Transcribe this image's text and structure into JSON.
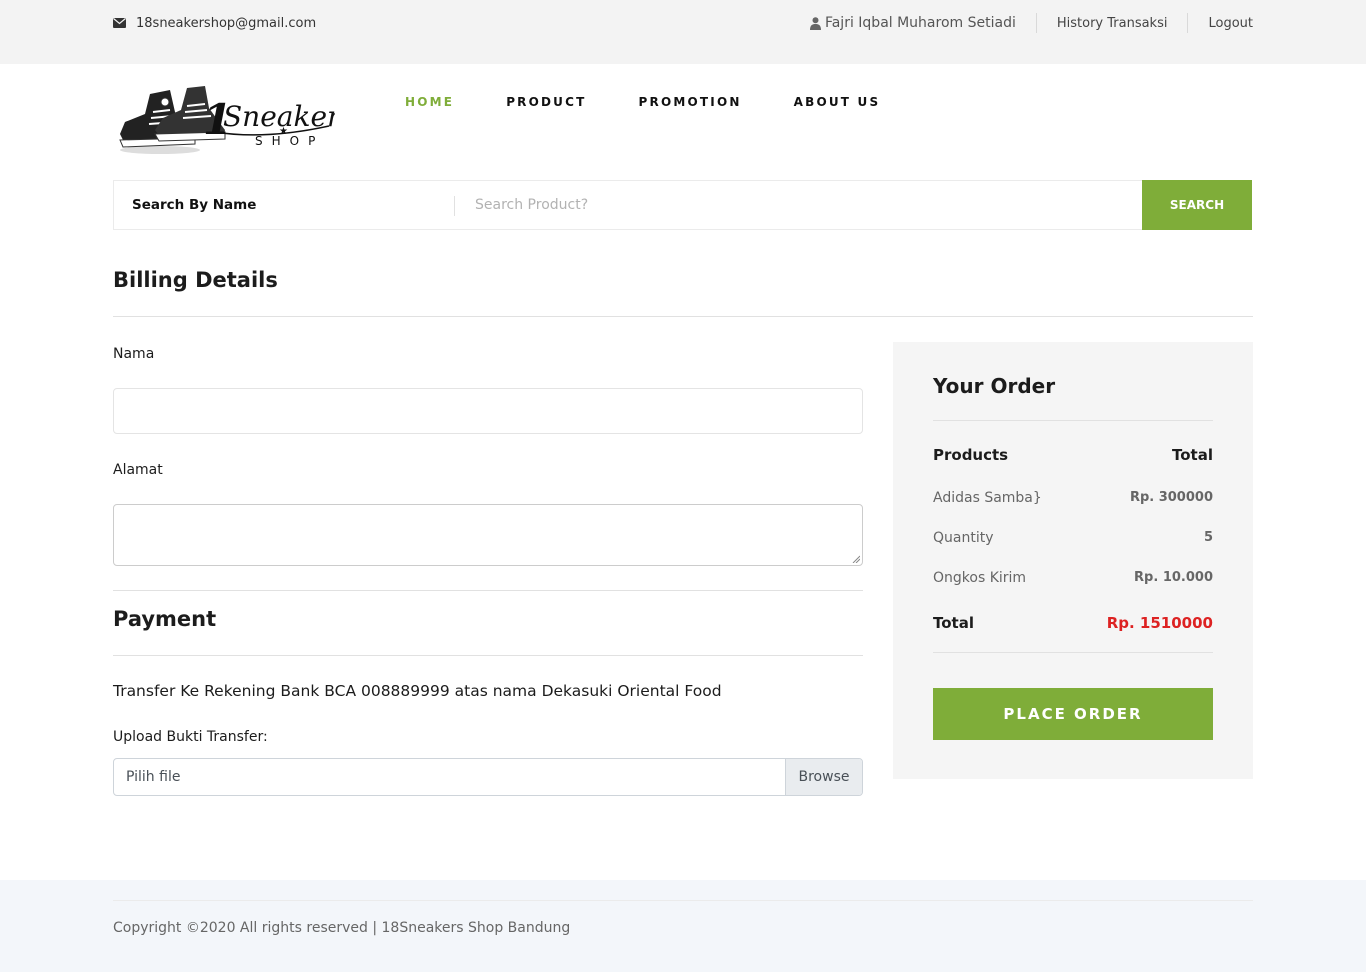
{
  "topbar": {
    "email": "18sneakershop@gmail.com",
    "user": "Fajri Iqbal Muharom Setiadi",
    "history": "History Transaksi",
    "logout": "Logout"
  },
  "nav": {
    "home": "HOME",
    "product": "PRODUCT",
    "promotion": "PROMOTION",
    "about": "ABOUT US"
  },
  "search": {
    "label": "Search By Name",
    "placeholder": "Search Product?",
    "button": "SEARCH"
  },
  "billing": {
    "title": "Billing Details",
    "nama_label": "Nama",
    "alamat_label": "Alamat"
  },
  "payment": {
    "title": "Payment",
    "info": "Transfer Ke Rekening Bank BCA 008889999 atas nama Dekasuki Oriental Food",
    "upload_label": "Upload Bukti Transfer:",
    "file_placeholder": "Pilih file",
    "browse": "Browse"
  },
  "order": {
    "title": "Your Order",
    "col_products": "Products",
    "col_total": "Total",
    "rows": [
      {
        "label": "Adidas Samba}",
        "value": "Rp. 300000"
      },
      {
        "label": "Quantity",
        "value": "5"
      },
      {
        "label": "Ongkos Kirim",
        "value": "Rp. 10.000"
      }
    ],
    "total_label": "Total",
    "total_value": "Rp. 1510000",
    "place_order": "PLACE ORDER"
  },
  "footer": {
    "copyright": "Copyright ©2020 All rights reserved | 18Sneakers Shop Bandung"
  },
  "colors": {
    "accent": "#7fad39",
    "total_red": "#dd2222"
  }
}
